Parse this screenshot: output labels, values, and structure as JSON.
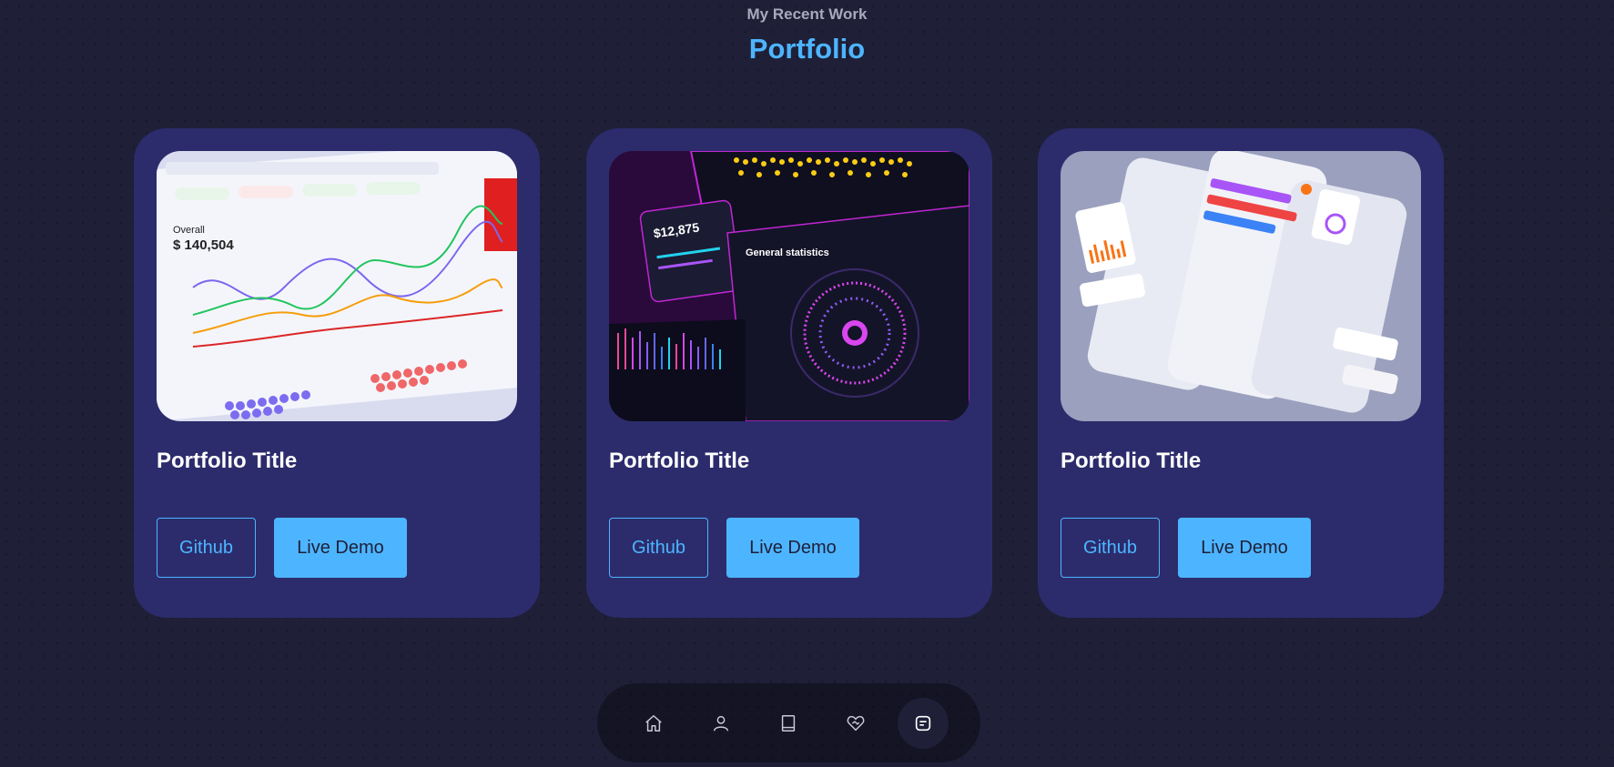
{
  "header": {
    "subtitle": "My Recent Work",
    "title": "Portfolio"
  },
  "portfolio": {
    "items": [
      {
        "title": "Portfolio Title",
        "github_label": "Github",
        "demo_label": "Live Demo",
        "image": "finance-dashboard-screenshot"
      },
      {
        "title": "Portfolio Title",
        "github_label": "Github",
        "demo_label": "Live Demo",
        "image": "dark-analytics-dashboard-screenshot"
      },
      {
        "title": "Portfolio Title",
        "github_label": "Github",
        "demo_label": "Live Demo",
        "image": "mobile-app-screens-screenshot"
      }
    ]
  },
  "nav": {
    "items": [
      {
        "icon": "home-icon"
      },
      {
        "icon": "user-icon"
      },
      {
        "icon": "book-icon"
      },
      {
        "icon": "handshake-heart-icon"
      },
      {
        "icon": "message-icon",
        "active": true
      }
    ]
  },
  "colors": {
    "background": "#1f1f38",
    "card": "#2c2c6c",
    "accent": "#4db5ff",
    "text": "#ffffff",
    "muted": "#a9a9be"
  }
}
